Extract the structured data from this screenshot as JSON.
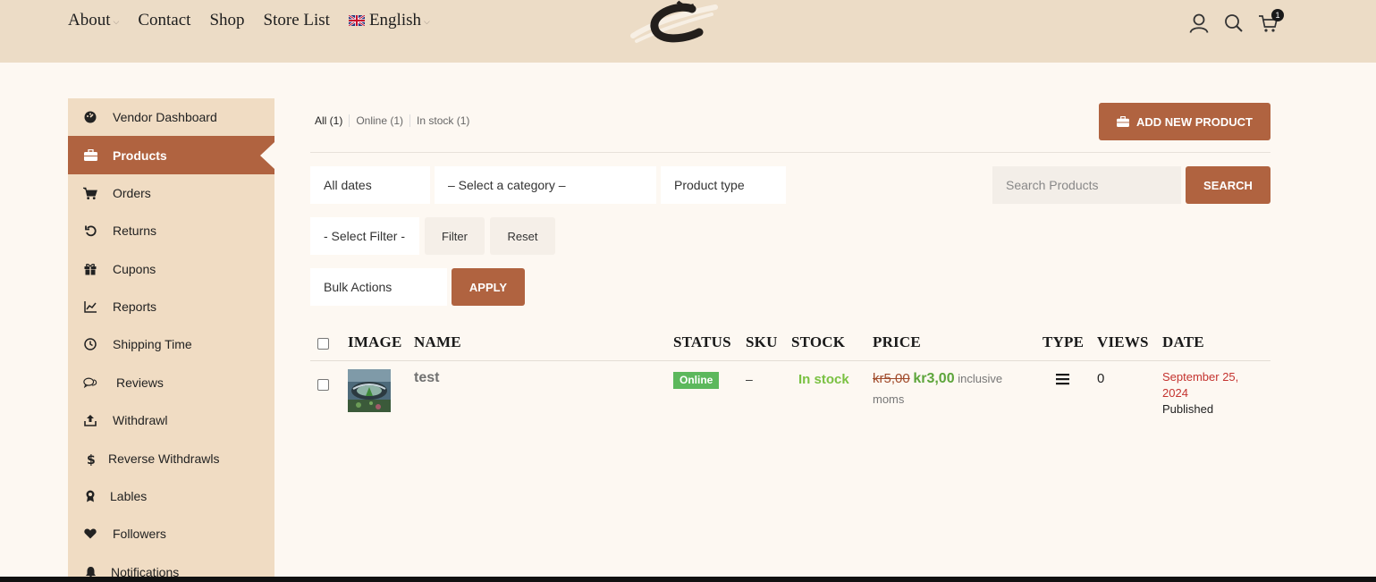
{
  "header": {
    "nav": [
      {
        "label": "About",
        "has_caret": true
      },
      {
        "label": "Contact",
        "has_caret": false
      },
      {
        "label": "Shop",
        "has_caret": false
      },
      {
        "label": "Store List",
        "has_caret": false
      }
    ],
    "language": {
      "label": "English",
      "flag": "uk-flag-icon"
    },
    "icons": [
      "user-icon",
      "search-icon",
      "cart-icon"
    ],
    "cart_count": "1"
  },
  "sidebar": {
    "items": [
      {
        "label": "Vendor Dashboard",
        "icon": "dashboard-icon"
      },
      {
        "label": "Products",
        "icon": "briefcase-icon",
        "active": true
      },
      {
        "label": "Orders",
        "icon": "cart-icon"
      },
      {
        "label": "Returns",
        "icon": "undo-icon"
      },
      {
        "label": "Cupons",
        "icon": "gift-icon"
      },
      {
        "label": "Reports",
        "icon": "line-chart-icon"
      },
      {
        "label": "Shipping Time",
        "icon": "clock-icon"
      },
      {
        "label": "Reviews",
        "icon": "comments-icon"
      },
      {
        "label": "Withdrawl",
        "icon": "upload-icon"
      },
      {
        "label": "Reverse Withdrawls",
        "icon": "dollar-icon"
      },
      {
        "label": "Lables",
        "icon": "award-icon"
      },
      {
        "label": "Followers",
        "icon": "heart-icon"
      },
      {
        "label": "Notifications",
        "icon": "bell-icon"
      }
    ]
  },
  "main": {
    "tabs": [
      {
        "label": "All (1)",
        "current": true
      },
      {
        "label": "Online (1)"
      },
      {
        "label": "In stock (1)"
      }
    ],
    "add_button": "ADD NEW PRODUCT",
    "filters": {
      "dates": "All dates",
      "category": "– Select a category –",
      "product_type": "Product type",
      "search_placeholder": "Search Products",
      "search_button": "SEARCH",
      "select_filter": "- Select Filter -",
      "filter_button": "Filter",
      "reset_button": "Reset",
      "bulk_actions": "Bulk Actions",
      "apply_button": "APPLY"
    },
    "table": {
      "columns": [
        "IMAGE",
        "NAME",
        "STATUS",
        "SKU",
        "STOCK",
        "PRICE",
        "TYPE",
        "VIEWS",
        "DATE"
      ],
      "rows": [
        {
          "name": "test",
          "status": "Online",
          "sku": "–",
          "stock": "In stock",
          "price_old": "kr5,00",
          "price_new": "kr3,00",
          "price_note": "inclusive moms",
          "type_icon": "list-icon",
          "views": "0",
          "date": "September 25, 2024",
          "published": "Published"
        }
      ]
    }
  },
  "colors": {
    "header_bg": "#ecdcc6",
    "sidebar_bg": "#f0dcc3",
    "accent": "#b06340",
    "page_bg": "#fdf8f2",
    "online_badge": "#5cb85c",
    "in_stock": "#7ac142"
  }
}
